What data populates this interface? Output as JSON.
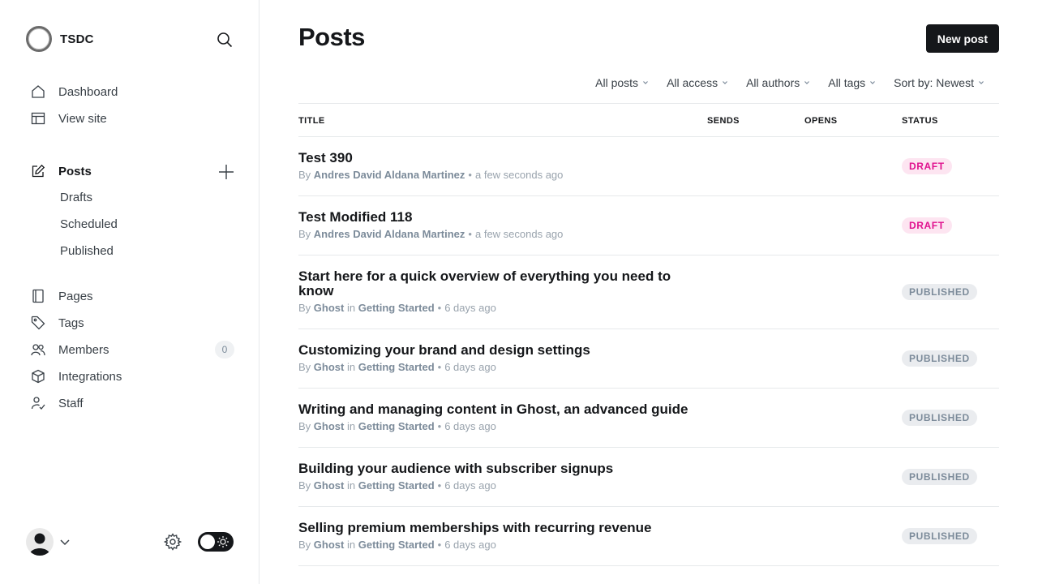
{
  "brand": {
    "name": "TSDC"
  },
  "nav": {
    "dashboard": "Dashboard",
    "view_site": "View site",
    "posts": "Posts",
    "posts_sub": [
      "Drafts",
      "Scheduled",
      "Published"
    ],
    "pages": "Pages",
    "tags": "Tags",
    "members": "Members",
    "members_count": "0",
    "integrations": "Integrations",
    "staff": "Staff"
  },
  "header": {
    "title": "Posts",
    "new_post_label": "New post"
  },
  "filters": [
    "All posts",
    "All access",
    "All authors",
    "All tags",
    "Sort by: Newest"
  ],
  "table": {
    "columns": {
      "title": "TITLE",
      "sends": "SENDS",
      "opens": "OPENS",
      "status": "STATUS"
    },
    "rows": [
      {
        "title": "Test 390",
        "by": "By",
        "author": "Andres David Aldana Martinez",
        "in": "",
        "tag": "",
        "time": "a few seconds ago",
        "status": "DRAFT"
      },
      {
        "title": "Test Modified 118",
        "by": "By",
        "author": "Andres David Aldana Martinez",
        "in": "",
        "tag": "",
        "time": "a few seconds ago",
        "status": "DRAFT"
      },
      {
        "title": "Start here for a quick overview of everything you need to know",
        "by": "By",
        "author": "Ghost",
        "in": "in",
        "tag": "Getting Started",
        "time": "6 days ago",
        "status": "PUBLISHED"
      },
      {
        "title": "Customizing your brand and design settings",
        "by": "By",
        "author": "Ghost",
        "in": "in",
        "tag": "Getting Started",
        "time": "6 days ago",
        "status": "PUBLISHED"
      },
      {
        "title": "Writing and managing content in Ghost, an advanced guide",
        "by": "By",
        "author": "Ghost",
        "in": "in",
        "tag": "Getting Started",
        "time": "6 days ago",
        "status": "PUBLISHED"
      },
      {
        "title": "Building your audience with subscriber signups",
        "by": "By",
        "author": "Ghost",
        "in": "in",
        "tag": "Getting Started",
        "time": "6 days ago",
        "status": "PUBLISHED"
      },
      {
        "title": "Selling premium memberships with recurring revenue",
        "by": "By",
        "author": "Ghost",
        "in": "in",
        "tag": "Getting Started",
        "time": "6 days ago",
        "status": "PUBLISHED"
      }
    ]
  },
  "icons": {
    "search": "search-icon",
    "dashboard": "home-icon",
    "view_site": "layout-icon",
    "posts": "pencil-icon",
    "add": "plus-icon",
    "pages": "page-icon",
    "tags": "tag-icon",
    "members": "members-icon",
    "integrations": "cube-icon",
    "staff": "staff-icon",
    "settings": "gear-icon",
    "theme": "sun-icon"
  },
  "colors": {
    "draft": "#e0128f",
    "draft_bg": "#fde5f1",
    "published_bg": "#eaecef",
    "primary": "#15171a"
  }
}
